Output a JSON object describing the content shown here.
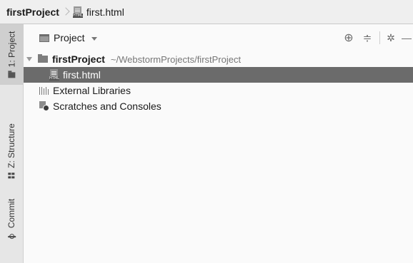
{
  "breadcrumb": {
    "project": "firstProject",
    "file": "first.html"
  },
  "tool_window_strip": {
    "tabs": [
      {
        "label": "1: Project",
        "icon": "folder-icon",
        "active": true
      },
      {
        "label": "Z: Structure",
        "icon": "structure-icon",
        "active": false
      },
      {
        "label": "Commit",
        "icon": "commit-icon",
        "active": false
      }
    ]
  },
  "panel": {
    "view_selector": "Project",
    "tools": {
      "locate": "⊕",
      "collapse": "≑",
      "settings": "✲",
      "minimize": "—"
    }
  },
  "tree": {
    "root": {
      "name": "firstProject",
      "path": "~/WebstormProjects/firstProject",
      "expanded": true
    },
    "selected_file": "first.html",
    "external_libraries": "External Libraries",
    "scratches": "Scratches and Consoles"
  },
  "colors": {
    "selection_bg": "#6b6b6b",
    "strip_active_bg": "#cfcfcf",
    "panel_bg": "#fafafa"
  }
}
